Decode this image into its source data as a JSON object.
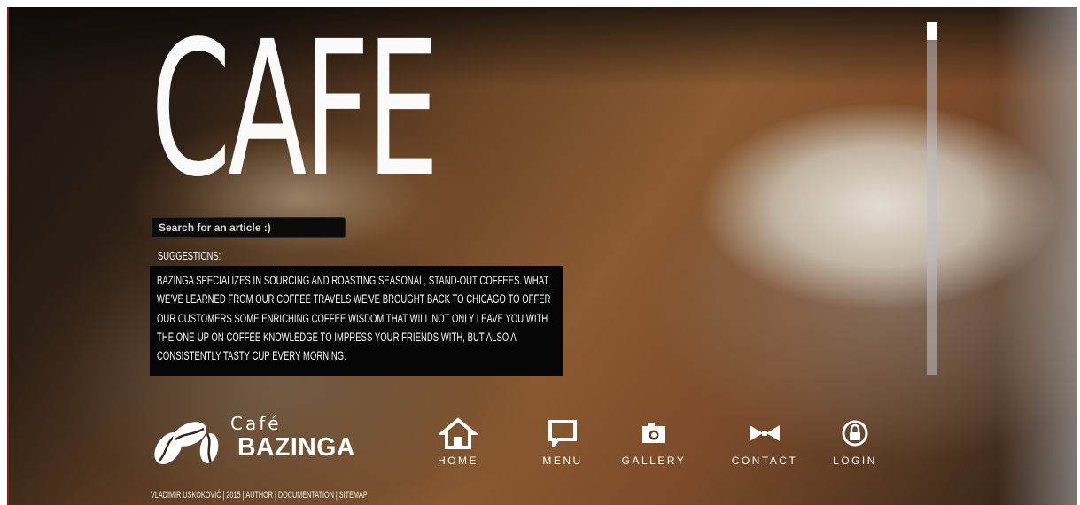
{
  "hero": {
    "title": "CAFE"
  },
  "search": {
    "placeholder": "Search for an article :)"
  },
  "suggestions": {
    "label": "SUGGESTIONS:",
    "text": "BAZINGA SPECIALIZES IN SOURCING AND ROASTING SEASONAL, STAND-OUT COFFEES. WHAT WE'VE LEARNED FROM OUR COFFEE TRAVELS WE'VE BROUGHT BACK TO CHICAGO TO OFFER OUR CUSTOMERS SOME ENRICHING COFFEE WISDOM THAT WILL NOT ONLY LEAVE YOU WITH THE ONE-UP ON COFFEE KNOWLEDGE TO IMPRESS YOUR FRIENDS WITH, BUT ALSO A CONSISTENTLY TASTY CUP EVERY MORNING."
  },
  "logo": {
    "cafe": "Café",
    "brand": "BAZINGA"
  },
  "nav": [
    {
      "label": "HOME",
      "icon": "home-icon"
    },
    {
      "label": "MENU",
      "icon": "speech-bubble-icon"
    },
    {
      "label": "GALLERY",
      "icon": "camera-icon"
    },
    {
      "label": "CONTACT",
      "icon": "bowtie-icon"
    },
    {
      "label": "LOGIN",
      "icon": "lock-icon"
    }
  ],
  "footer": {
    "credit": "VLADIMIR USKOKOVIĆ | 2015",
    "links": [
      "AUTHOR",
      "DOCUMENTATION",
      "SITEMAP"
    ]
  },
  "colors": {
    "text": "#ffffff",
    "panel": "#050505",
    "scroll_thumb": "#ffffff"
  }
}
